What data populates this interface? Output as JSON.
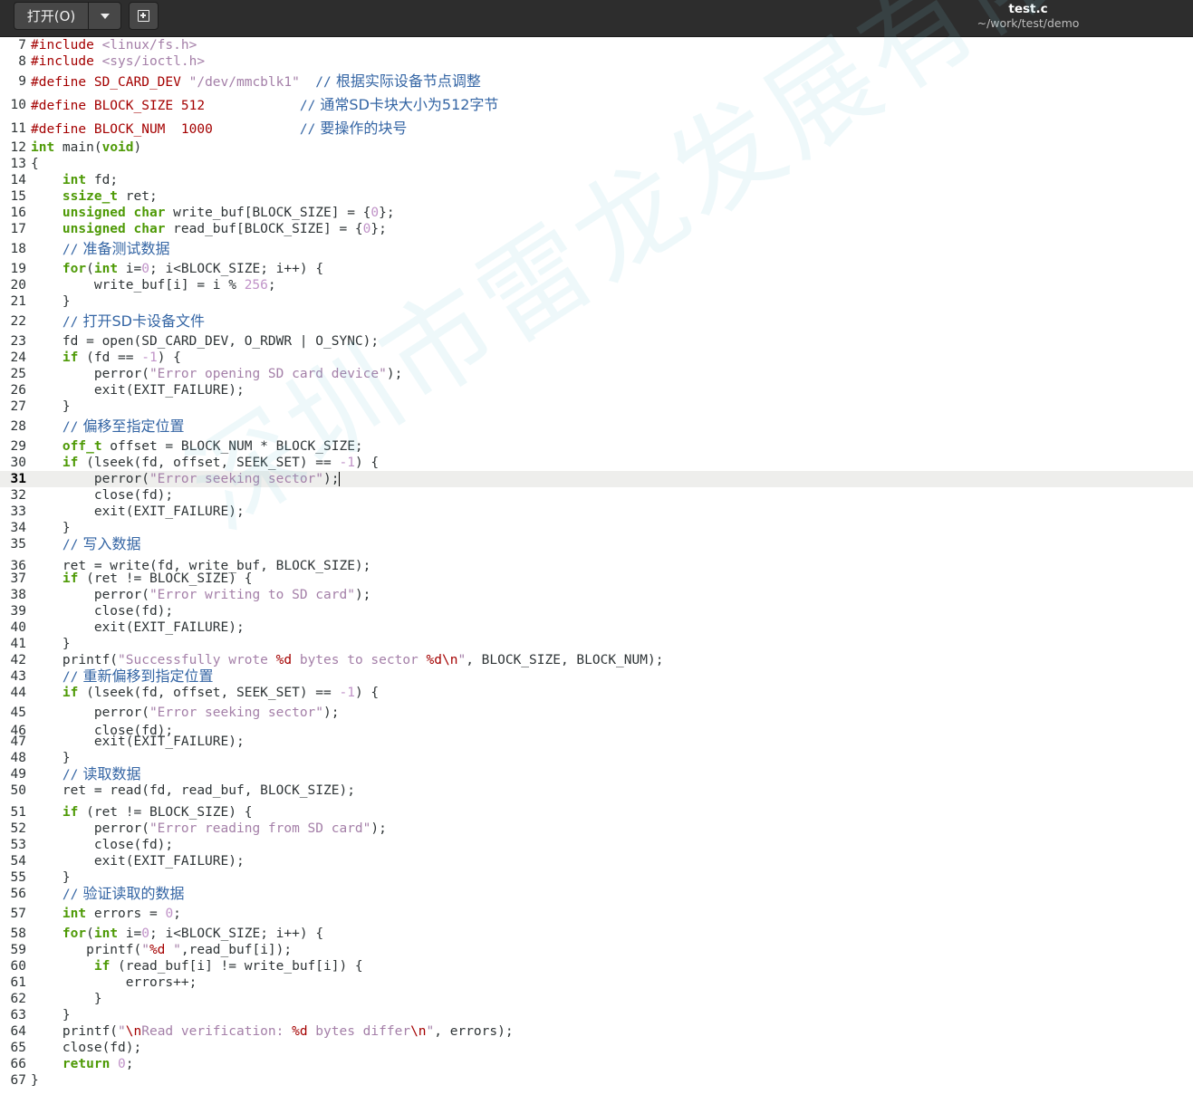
{
  "header": {
    "open_button_label": "打开(O)",
    "open_menu_icon": "chevron-down-icon",
    "new_document_icon": "new-document-icon",
    "file_name": "test.c",
    "file_path": "~/work/test/demo"
  },
  "editor": {
    "current_line": 31,
    "lines": [
      {
        "n": "7",
        "t": "#include <linux/fs.h>"
      },
      {
        "n": "8",
        "t": "#include <sys/ioctl.h>"
      },
      {
        "n": "9",
        "t": "#define SD_CARD_DEV \"/dev/mmcblk1\"  // 根据实际设备节点调整"
      },
      {
        "n": "10",
        "t": "#define BLOCK_SIZE 512            // 通常SD卡块大小为512字节"
      },
      {
        "n": "11",
        "t": "#define BLOCK_NUM  1000           // 要操作的块号"
      },
      {
        "n": "12",
        "t": "int main(void)"
      },
      {
        "n": "13",
        "t": "{"
      },
      {
        "n": "14",
        "t": "    int fd;"
      },
      {
        "n": "15",
        "t": "    ssize_t ret;"
      },
      {
        "n": "16",
        "t": "    unsigned char write_buf[BLOCK_SIZE] = {0};"
      },
      {
        "n": "17",
        "t": "    unsigned char read_buf[BLOCK_SIZE] = {0};"
      },
      {
        "n": "18",
        "t": "    // 准备测试数据"
      },
      {
        "n": "19",
        "t": "    for(int i=0; i<BLOCK_SIZE; i++) {"
      },
      {
        "n": "20",
        "t": "        write_buf[i] = i % 256;"
      },
      {
        "n": "21",
        "t": "    }"
      },
      {
        "n": "22",
        "t": "    // 打开SD卡设备文件"
      },
      {
        "n": "23",
        "t": "    fd = open(SD_CARD_DEV, O_RDWR | O_SYNC);"
      },
      {
        "n": "24",
        "t": "    if (fd == -1) {"
      },
      {
        "n": "25",
        "t": "        perror(\"Error opening SD card device\");"
      },
      {
        "n": "26",
        "t": "        exit(EXIT_FAILURE);"
      },
      {
        "n": "27",
        "t": "    }"
      },
      {
        "n": "28",
        "t": "    // 偏移至指定位置"
      },
      {
        "n": "29",
        "t": "    off_t offset = BLOCK_NUM * BLOCK_SIZE;"
      },
      {
        "n": "30",
        "t": "    if (lseek(fd, offset, SEEK_SET) == -1) {"
      },
      {
        "n": "31",
        "t": "        perror(\"Error seeking sector\");"
      },
      {
        "n": "32",
        "t": "        close(fd);"
      },
      {
        "n": "33",
        "t": "        exit(EXIT_FAILURE);"
      },
      {
        "n": "34",
        "t": "    }"
      },
      {
        "n": "35",
        "t": "    // 写入数据"
      },
      {
        "n": "36",
        "t": "    ret = write(fd, write_buf, BLOCK_SIZE);"
      },
      {
        "n": "37",
        "t": "    if (ret != BLOCK_SIZE) {"
      },
      {
        "n": "38",
        "t": "        perror(\"Error writing to SD card\");"
      },
      {
        "n": "39",
        "t": "        close(fd);"
      },
      {
        "n": "40",
        "t": "        exit(EXIT_FAILURE);"
      },
      {
        "n": "41",
        "t": "    }"
      },
      {
        "n": "42",
        "t": "    printf(\"Successfully wrote %d bytes to sector %d\\n\", BLOCK_SIZE, BLOCK_NUM);"
      },
      {
        "n": "43",
        "t": "    // 重新偏移到指定位置"
      },
      {
        "n": "44",
        "t": "    if (lseek(fd, offset, SEEK_SET) == -1) {"
      },
      {
        "n": "45",
        "t": "        perror(\"Error seeking sector\");"
      },
      {
        "n": "46",
        "t": "        close(fd);"
      },
      {
        "n": "47",
        "t": "        exit(EXIT_FAILURE);"
      },
      {
        "n": "48",
        "t": "    }"
      },
      {
        "n": "49",
        "t": "    // 读取数据"
      },
      {
        "n": "50",
        "t": "    ret = read(fd, read_buf, BLOCK_SIZE);"
      },
      {
        "n": "51",
        "t": "    if (ret != BLOCK_SIZE) {"
      },
      {
        "n": "52",
        "t": "        perror(\"Error reading from SD card\");"
      },
      {
        "n": "53",
        "t": "        close(fd);"
      },
      {
        "n": "54",
        "t": "        exit(EXIT_FAILURE);"
      },
      {
        "n": "55",
        "t": "    }"
      },
      {
        "n": "56",
        "t": "    // 验证读取的数据"
      },
      {
        "n": "57",
        "t": "    int errors = 0;"
      },
      {
        "n": "58",
        "t": "    for(int i=0; i<BLOCK_SIZE; i++) {"
      },
      {
        "n": "59",
        "t": "       printf(\"%d \",read_buf[i]);"
      },
      {
        "n": "60",
        "t": "        if (read_buf[i] != write_buf[i]) {"
      },
      {
        "n": "61",
        "t": "            errors++;"
      },
      {
        "n": "62",
        "t": "        }"
      },
      {
        "n": "63",
        "t": "    }"
      },
      {
        "n": "64",
        "t": "    printf(\"\\nRead verification: %d bytes differ\\n\", errors);"
      },
      {
        "n": "65",
        "t": "    close(fd);"
      },
      {
        "n": "66",
        "t": "    return 0;"
      },
      {
        "n": "67",
        "t": "}"
      }
    ]
  },
  "watermark": "深圳市雷龙发展有限公司",
  "colors": {
    "header_bg": "#2d2d2d",
    "keyword": "#4e9a06",
    "string": "#a47fa8",
    "comment": "#3465a4",
    "preproc": "#a40000",
    "current_line_bg": "#eeeeec"
  }
}
